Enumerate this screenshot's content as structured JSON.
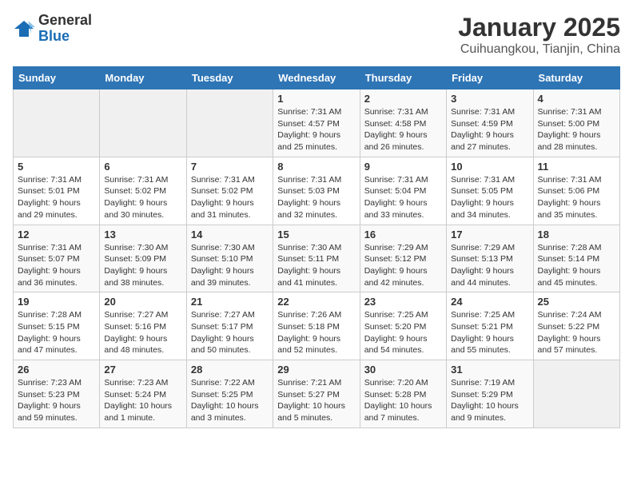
{
  "header": {
    "logo_general": "General",
    "logo_blue": "Blue",
    "title": "January 2025",
    "subtitle": "Cuihuangkou, Tianjin, China"
  },
  "weekdays": [
    "Sunday",
    "Monday",
    "Tuesday",
    "Wednesday",
    "Thursday",
    "Friday",
    "Saturday"
  ],
  "weeks": [
    [
      {
        "day": "",
        "info": ""
      },
      {
        "day": "",
        "info": ""
      },
      {
        "day": "",
        "info": ""
      },
      {
        "day": "1",
        "info": "Sunrise: 7:31 AM\nSunset: 4:57 PM\nDaylight: 9 hours\nand 25 minutes."
      },
      {
        "day": "2",
        "info": "Sunrise: 7:31 AM\nSunset: 4:58 PM\nDaylight: 9 hours\nand 26 minutes."
      },
      {
        "day": "3",
        "info": "Sunrise: 7:31 AM\nSunset: 4:59 PM\nDaylight: 9 hours\nand 27 minutes."
      },
      {
        "day": "4",
        "info": "Sunrise: 7:31 AM\nSunset: 5:00 PM\nDaylight: 9 hours\nand 28 minutes."
      }
    ],
    [
      {
        "day": "5",
        "info": "Sunrise: 7:31 AM\nSunset: 5:01 PM\nDaylight: 9 hours\nand 29 minutes."
      },
      {
        "day": "6",
        "info": "Sunrise: 7:31 AM\nSunset: 5:02 PM\nDaylight: 9 hours\nand 30 minutes."
      },
      {
        "day": "7",
        "info": "Sunrise: 7:31 AM\nSunset: 5:02 PM\nDaylight: 9 hours\nand 31 minutes."
      },
      {
        "day": "8",
        "info": "Sunrise: 7:31 AM\nSunset: 5:03 PM\nDaylight: 9 hours\nand 32 minutes."
      },
      {
        "day": "9",
        "info": "Sunrise: 7:31 AM\nSunset: 5:04 PM\nDaylight: 9 hours\nand 33 minutes."
      },
      {
        "day": "10",
        "info": "Sunrise: 7:31 AM\nSunset: 5:05 PM\nDaylight: 9 hours\nand 34 minutes."
      },
      {
        "day": "11",
        "info": "Sunrise: 7:31 AM\nSunset: 5:06 PM\nDaylight: 9 hours\nand 35 minutes."
      }
    ],
    [
      {
        "day": "12",
        "info": "Sunrise: 7:31 AM\nSunset: 5:07 PM\nDaylight: 9 hours\nand 36 minutes."
      },
      {
        "day": "13",
        "info": "Sunrise: 7:30 AM\nSunset: 5:09 PM\nDaylight: 9 hours\nand 38 minutes."
      },
      {
        "day": "14",
        "info": "Sunrise: 7:30 AM\nSunset: 5:10 PM\nDaylight: 9 hours\nand 39 minutes."
      },
      {
        "day": "15",
        "info": "Sunrise: 7:30 AM\nSunset: 5:11 PM\nDaylight: 9 hours\nand 41 minutes."
      },
      {
        "day": "16",
        "info": "Sunrise: 7:29 AM\nSunset: 5:12 PM\nDaylight: 9 hours\nand 42 minutes."
      },
      {
        "day": "17",
        "info": "Sunrise: 7:29 AM\nSunset: 5:13 PM\nDaylight: 9 hours\nand 44 minutes."
      },
      {
        "day": "18",
        "info": "Sunrise: 7:28 AM\nSunset: 5:14 PM\nDaylight: 9 hours\nand 45 minutes."
      }
    ],
    [
      {
        "day": "19",
        "info": "Sunrise: 7:28 AM\nSunset: 5:15 PM\nDaylight: 9 hours\nand 47 minutes."
      },
      {
        "day": "20",
        "info": "Sunrise: 7:27 AM\nSunset: 5:16 PM\nDaylight: 9 hours\nand 48 minutes."
      },
      {
        "day": "21",
        "info": "Sunrise: 7:27 AM\nSunset: 5:17 PM\nDaylight: 9 hours\nand 50 minutes."
      },
      {
        "day": "22",
        "info": "Sunrise: 7:26 AM\nSunset: 5:18 PM\nDaylight: 9 hours\nand 52 minutes."
      },
      {
        "day": "23",
        "info": "Sunrise: 7:25 AM\nSunset: 5:20 PM\nDaylight: 9 hours\nand 54 minutes."
      },
      {
        "day": "24",
        "info": "Sunrise: 7:25 AM\nSunset: 5:21 PM\nDaylight: 9 hours\nand 55 minutes."
      },
      {
        "day": "25",
        "info": "Sunrise: 7:24 AM\nSunset: 5:22 PM\nDaylight: 9 hours\nand 57 minutes."
      }
    ],
    [
      {
        "day": "26",
        "info": "Sunrise: 7:23 AM\nSunset: 5:23 PM\nDaylight: 9 hours\nand 59 minutes."
      },
      {
        "day": "27",
        "info": "Sunrise: 7:23 AM\nSunset: 5:24 PM\nDaylight: 10 hours\nand 1 minute."
      },
      {
        "day": "28",
        "info": "Sunrise: 7:22 AM\nSunset: 5:25 PM\nDaylight: 10 hours\nand 3 minutes."
      },
      {
        "day": "29",
        "info": "Sunrise: 7:21 AM\nSunset: 5:27 PM\nDaylight: 10 hours\nand 5 minutes."
      },
      {
        "day": "30",
        "info": "Sunrise: 7:20 AM\nSunset: 5:28 PM\nDaylight: 10 hours\nand 7 minutes."
      },
      {
        "day": "31",
        "info": "Sunrise: 7:19 AM\nSunset: 5:29 PM\nDaylight: 10 hours\nand 9 minutes."
      },
      {
        "day": "",
        "info": ""
      }
    ]
  ]
}
